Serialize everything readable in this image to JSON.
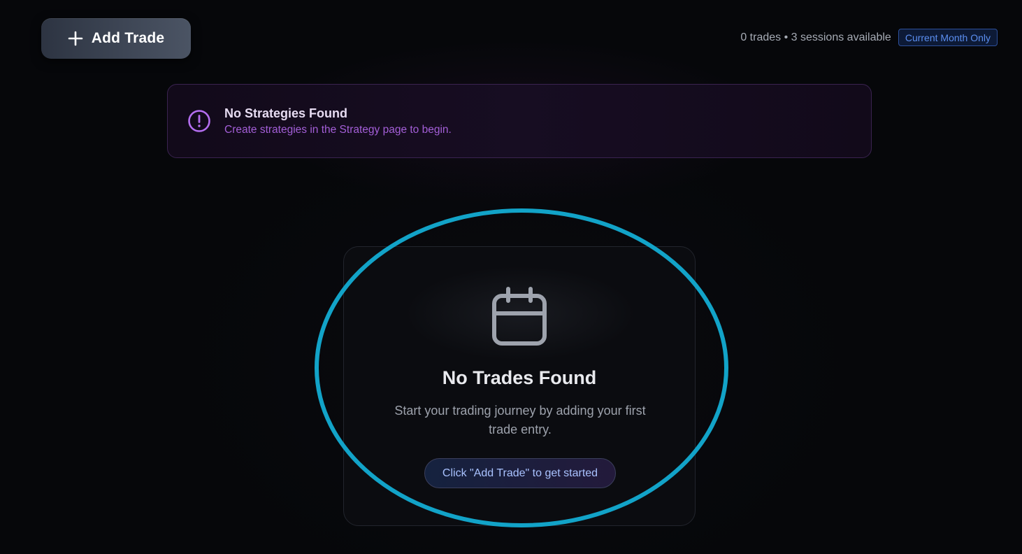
{
  "toolbar": {
    "add_trade_label": "Add Trade",
    "add_icon": "plus-icon"
  },
  "summary": {
    "text": "0 trades • 3 sessions available",
    "badge": "Current Month Only",
    "badge_color": "#5b8ef0"
  },
  "notice": {
    "icon": "alert-circle-icon",
    "title": "No Strategies Found",
    "subtitle": "Create strategies in the Strategy page to begin.",
    "accent_color": "#b46ef0"
  },
  "empty_state": {
    "icon": "calendar-icon",
    "title": "No Trades Found",
    "description": "Start your trading journey by adding your first trade entry.",
    "cta": "Click \"Add Trade\" to get started"
  },
  "annotation": {
    "highlight_color": "#12a3c8"
  }
}
